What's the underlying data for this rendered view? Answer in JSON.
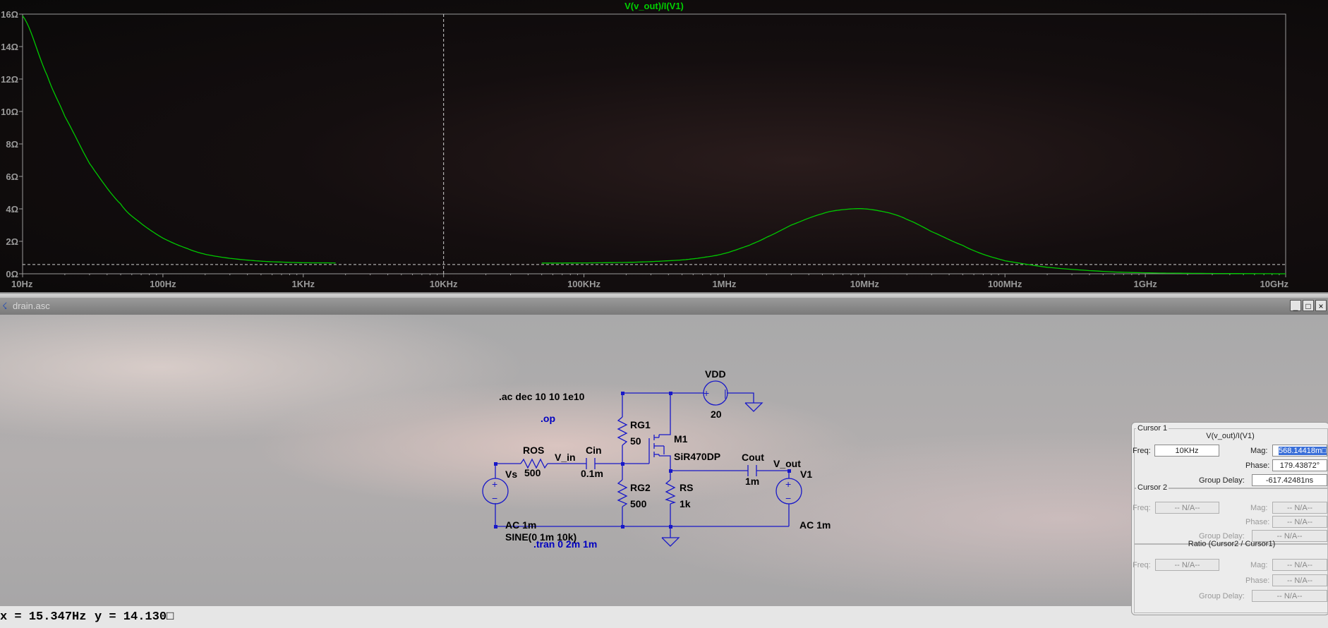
{
  "plot": {
    "trace_label": "V(v_out)/I(V1)",
    "y_ticks": [
      "16Ω",
      "14Ω",
      "12Ω",
      "10Ω",
      "8Ω",
      "6Ω",
      "4Ω",
      "2Ω",
      "0Ω"
    ],
    "x_ticks": [
      "10Hz",
      "100Hz",
      "1KHz",
      "10KHz",
      "100KHz",
      "1MHz",
      "10MHz",
      "100MHz",
      "1GHz",
      "10GHz"
    ],
    "colors": {
      "trace": "#00c800",
      "axes": "#9a9a9a",
      "cursor": "#d0d0d0"
    }
  },
  "chart_data": {
    "type": "line",
    "title": "V(v_out)/I(V1)",
    "xlabel": "",
    "ylabel": "",
    "x_scale": "log",
    "xlim": [
      10,
      10000000000
    ],
    "ylim": [
      0,
      16
    ],
    "grid": false,
    "series": [
      {
        "name": "V(v_out)/I(V1)",
        "x": [
          10,
          15,
          20,
          30,
          50,
          70,
          100,
          150,
          200,
          300,
          500,
          700,
          1000,
          1700,
          50000,
          100000,
          200000,
          300000,
          500000,
          700000,
          1000000,
          1500000,
          2000000,
          3000000,
          5000000,
          7000000,
          10000000,
          15000000,
          20000000,
          30000000,
          50000000,
          70000000,
          100000000,
          200000000,
          500000000,
          1000000000,
          2000000000,
          5000000000,
          10000000000
        ],
        "y": [
          15.9,
          12.2,
          9.7,
          6.8,
          4.3,
          3.1,
          2.2,
          1.55,
          1.2,
          0.95,
          0.78,
          0.72,
          0.68,
          0.67,
          0.66,
          0.67,
          0.7,
          0.75,
          0.85,
          1.0,
          1.25,
          1.75,
          2.25,
          3.0,
          3.7,
          3.95,
          4.0,
          3.75,
          3.35,
          2.6,
          1.75,
          1.2,
          0.8,
          0.4,
          0.15,
          0.06,
          0.03,
          0.01,
          0.0
        ]
      }
    ],
    "cursor_x": 10000,
    "cursor_y": 0.568
  },
  "schematic": {
    "window_title": "drain.asc",
    "window_buttons": [
      "_",
      "□",
      "×"
    ],
    "directives": {
      "ac": ".ac dec 10 10 1e10",
      "op": ".op",
      "tran": ".tran 0 2m 1m"
    },
    "components": {
      "vdd_name": "VDD",
      "vdd_value": "20",
      "rg1_name": "RG1",
      "rg1_value": "50",
      "rg2_name": "RG2",
      "rg2_value": "500",
      "m1_name": "M1",
      "m1_value": "SiR470DP",
      "rs_name": "RS",
      "rs_value": "1k",
      "ros_name": "ROS",
      "ros_value": "500",
      "cin_name": "Cin",
      "cin_value": "0.1m",
      "cout_name": "Cout",
      "cout_value": "1m",
      "vs_name": "Vs",
      "vs_ac": "AC 1m",
      "vs_sine": "SINE(0 1m 10k)",
      "v1_name": "V1",
      "v1_ac": "AC 1m"
    },
    "nets": {
      "v_in": "V_in",
      "v_out": "V_out"
    },
    "colors": {
      "wire": "#1818c8",
      "text": "#000000",
      "directive": "#0000c0"
    }
  },
  "status": {
    "x": "x = 15.347Hz",
    "y": "y = 14.130□"
  },
  "cursor_dialog": {
    "cursor1": {
      "group": "Cursor 1",
      "trace": "V(v_out)/I(V1)",
      "freq_label": "Freq:",
      "freq_value": "10KHz",
      "mag_label": "Mag:",
      "mag_value": "568.14418m□",
      "phase_label": "Phase:",
      "phase_value": "179.43872°",
      "gd_label": "Group Delay:",
      "gd_value": "-617.42481ns"
    },
    "cursor2": {
      "group": "Cursor 2",
      "freq_label": "Freq:",
      "freq_value": "-- N/A--",
      "mag_label": "Mag:",
      "mag_value": "-- N/A--",
      "phase_label": "Phase:",
      "phase_value": "-- N/A--",
      "gd_label": "Group Delay:",
      "gd_value": "-- N/A--"
    },
    "ratio": {
      "group": "Ratio (Cursor2 / Cursor1)",
      "freq_label": "Freq:",
      "freq_value": "-- N/A--",
      "mag_label": "Mag:",
      "mag_value": "-- N/A--",
      "phase_label": "Phase:",
      "phase_value": "-- N/A--",
      "gd_label": "Group Delay:",
      "gd_value": "-- N/A--"
    }
  }
}
